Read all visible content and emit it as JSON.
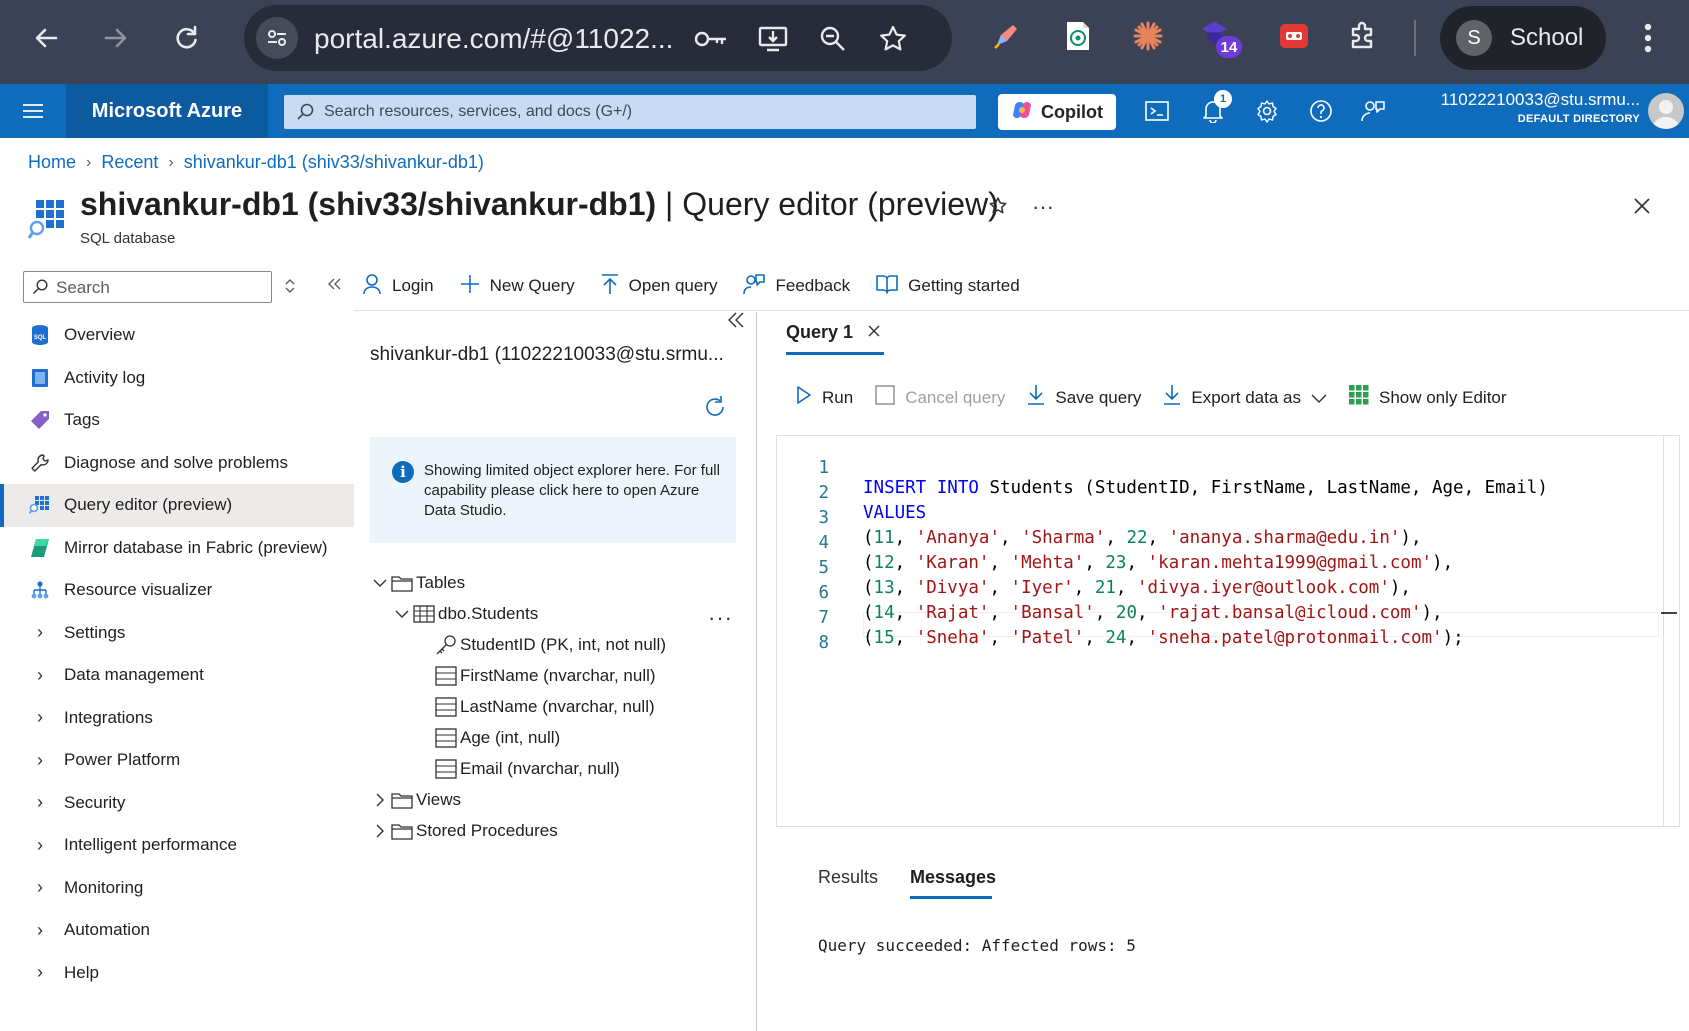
{
  "browser": {
    "url": "portal.azure.com/#@11022...",
    "extension_badge": "14",
    "profile_initial": "S",
    "profile_name": "School"
  },
  "azure_bar": {
    "brand": "Microsoft Azure",
    "search_placeholder": "Search resources, services, and docs (G+/)",
    "copilot_label": "Copilot",
    "notification_count": "1",
    "account_email": "11022210033@stu.srmu...",
    "account_directory": "DEFAULT DIRECTORY"
  },
  "breadcrumb": {
    "items": [
      "Home",
      "Recent",
      "shivankur-db1 (shiv33/shivankur-db1)"
    ]
  },
  "header": {
    "title_main": "shivankur-db1 (shiv33/shivankur-db1)",
    "title_suffix": " | Query editor (preview)",
    "subtitle": "SQL database",
    "more": "···"
  },
  "sidebar": {
    "search_placeholder": "Search",
    "items": [
      {
        "label": "Overview",
        "icon": "sql-db-icon"
      },
      {
        "label": "Activity log",
        "icon": "activity-log-icon"
      },
      {
        "label": "Tags",
        "icon": "tag-icon"
      },
      {
        "label": "Diagnose and solve problems",
        "icon": "wrench-icon"
      },
      {
        "label": "Query editor (preview)",
        "icon": "query-editor-icon"
      },
      {
        "label": "Mirror database in Fabric (preview)",
        "icon": "fabric-icon"
      },
      {
        "label": "Resource visualizer",
        "icon": "hierarchy-icon"
      },
      {
        "label": "Settings"
      },
      {
        "label": "Data management"
      },
      {
        "label": "Integrations"
      },
      {
        "label": "Power Platform"
      },
      {
        "label": "Security"
      },
      {
        "label": "Intelligent performance"
      },
      {
        "label": "Monitoring"
      },
      {
        "label": "Automation"
      },
      {
        "label": "Help"
      }
    ]
  },
  "commandbar": {
    "login": "Login",
    "new_query": "New Query",
    "open_query": "Open query",
    "feedback": "Feedback",
    "getting_started": "Getting started"
  },
  "explorer": {
    "connection": "shivankur-db1 (11022210033@stu.srmu...",
    "info_text": "Showing limited object explorer here. For full capability please click here to open Azure Data Studio.",
    "tree": {
      "tables": "Tables",
      "table_name": "dbo.Students",
      "columns": [
        "StudentID (PK, int, not null)",
        "FirstName (nvarchar, null)",
        "LastName (nvarchar, null)",
        "Age (int, null)",
        "Email (nvarchar, null)"
      ],
      "views": "Views",
      "stored_procedures": "Stored Procedures",
      "more": "···"
    }
  },
  "query": {
    "tab_label": "Query 1",
    "run": "Run",
    "cancel": "Cancel query",
    "save": "Save query",
    "export": "Export data as",
    "show_only_editor": "Show only Editor",
    "line_numbers": [
      "1",
      "2",
      "3",
      "4",
      "5",
      "6",
      "7",
      "8"
    ],
    "code": {
      "line1": {
        "kw1": "INSERT",
        "kw2": "INTO",
        "rest": " Students (StudentID, FirstName, LastName, Age, Email)"
      },
      "line2": {
        "kw": "VALUES"
      },
      "rows": [
        {
          "id": "11",
          "first": "'Ananya'",
          "last": "'Sharma'",
          "age": "22",
          "email": "'ananya.sharma@edu.in'",
          "end": "),"
        },
        {
          "id": "12",
          "first": "'Karan'",
          "last": "'Mehta'",
          "age": "23",
          "email": "'karan.mehta1999@gmail.com'",
          "end": "),"
        },
        {
          "id": "13",
          "first": "'Divya'",
          "last": "'Iyer'",
          "age": "21",
          "email": "'divya.iyer@outlook.com'",
          "end": "),"
        },
        {
          "id": "14",
          "first": "'Rajat'",
          "last": "'Bansal'",
          "age": "20",
          "email": "'rajat.bansal@icloud.com'",
          "end": "),"
        },
        {
          "id": "15",
          "first": "'Sneha'",
          "last": "'Patel'",
          "age": "24",
          "email": "'sneha.patel@protonmail.com'",
          "end": ");"
        }
      ]
    }
  },
  "results": {
    "tab_results": "Results",
    "tab_messages": "Messages",
    "message": "Query succeeded: Affected rows: 5"
  }
}
